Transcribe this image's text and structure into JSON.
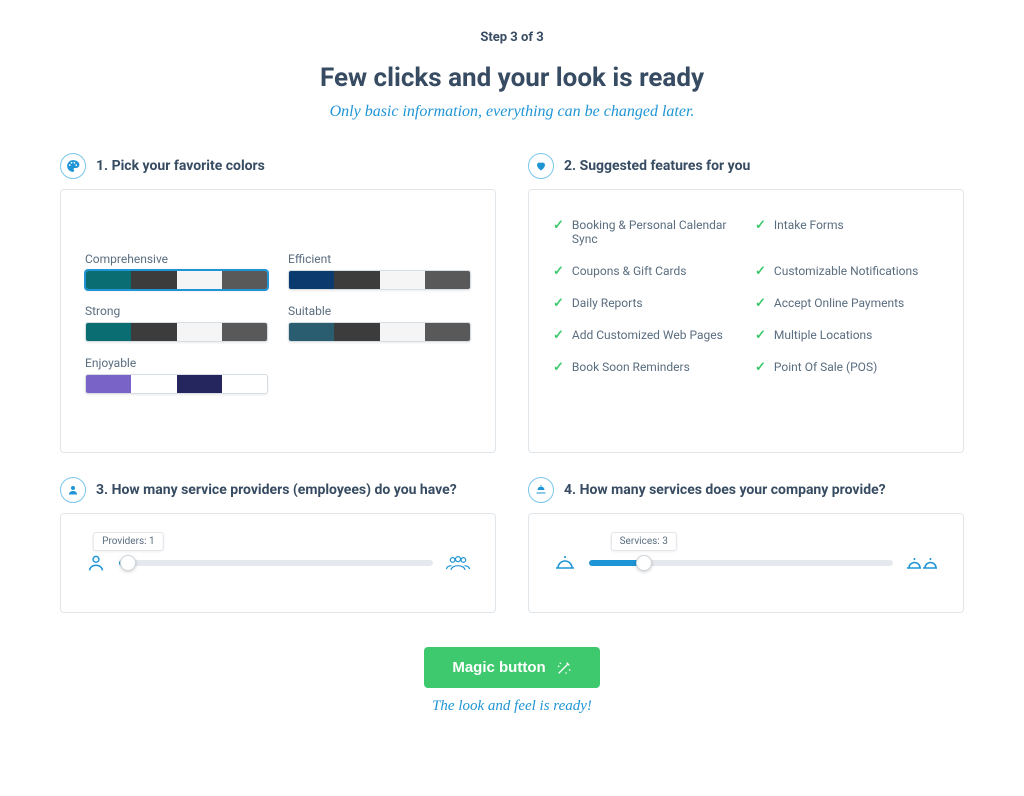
{
  "step_label": "Step 3 of 3",
  "title": "Few clicks and your look is ready",
  "subtitle": "Only basic information, everything can be changed later.",
  "sections": {
    "colors": {
      "title": "1. Pick your favorite colors",
      "palettes": [
        {
          "name": "Comprehensive",
          "selected": true,
          "colors": [
            "#0a6d72",
            "#3c3c3c",
            "#f5f5f5",
            "#595959"
          ]
        },
        {
          "name": "Efficient",
          "selected": false,
          "colors": [
            "#0a3a6e",
            "#3c3c3c",
            "#f5f5f5",
            "#595959"
          ]
        },
        {
          "name": "Strong",
          "selected": false,
          "colors": [
            "#0a6d72",
            "#3c3c3c",
            "#f5f5f5",
            "#595959"
          ]
        },
        {
          "name": "Suitable",
          "selected": false,
          "colors": [
            "#2a5d70",
            "#3c3c3c",
            "#f5f5f5",
            "#595959"
          ]
        },
        {
          "name": "Enjoyable",
          "selected": false,
          "colors": [
            "#7a63c7",
            "#ffffff",
            "#25265e",
            "#ffffff"
          ]
        }
      ]
    },
    "features": {
      "title": "2. Suggested features for you",
      "items": [
        "Booking & Personal Calendar Sync",
        "Intake Forms",
        "Coupons & Gift Cards",
        "Customizable Notifications",
        "Daily Reports",
        "Accept Online Payments",
        "Add Customized Web Pages",
        "Multiple Locations",
        "Book Soon Reminders",
        "Point Of Sale (POS)"
      ]
    },
    "providers": {
      "title": "3. How many service providers (employees) do you have?",
      "tooltip": "Providers: 1",
      "value_pct": 3
    },
    "services": {
      "title": "4. How many services does your company provide?",
      "tooltip": "Services: 3",
      "value_pct": 18
    }
  },
  "footer": {
    "button": "Magic button",
    "caption": "The look and feel is ready!"
  }
}
